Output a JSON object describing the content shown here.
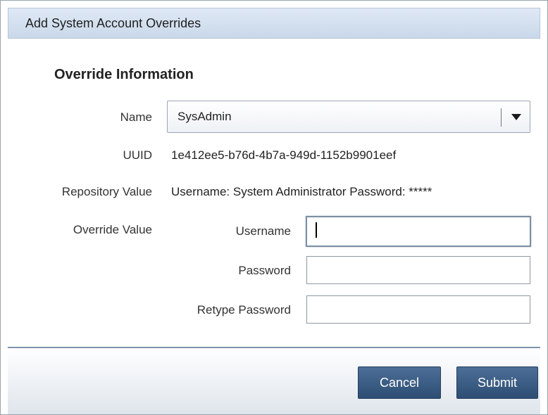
{
  "dialog": {
    "title": "Add System Account Overrides"
  },
  "section": {
    "title": "Override Information"
  },
  "fields": {
    "name_label": "Name",
    "name_value": "SysAdmin",
    "uuid_label": "UUID",
    "uuid_value": "1e412ee5-b76d-4b7a-949d-1152b9901eef",
    "repository_label": "Repository Value",
    "repository_value": "Username: System Administrator Password: *****",
    "override_label": "Override Value",
    "username_label": "Username",
    "username_value": "",
    "password_label": "Password",
    "password_value": "",
    "retype_label": "Retype Password",
    "retype_value": ""
  },
  "buttons": {
    "cancel": "Cancel",
    "submit": "Submit"
  },
  "icons": {
    "dropdown": "chevron-down-icon"
  },
  "colors": {
    "button_bg": "#3b5d85",
    "titlebar_bg": "#d3e0ef",
    "footer_border": "#7f93ad"
  }
}
